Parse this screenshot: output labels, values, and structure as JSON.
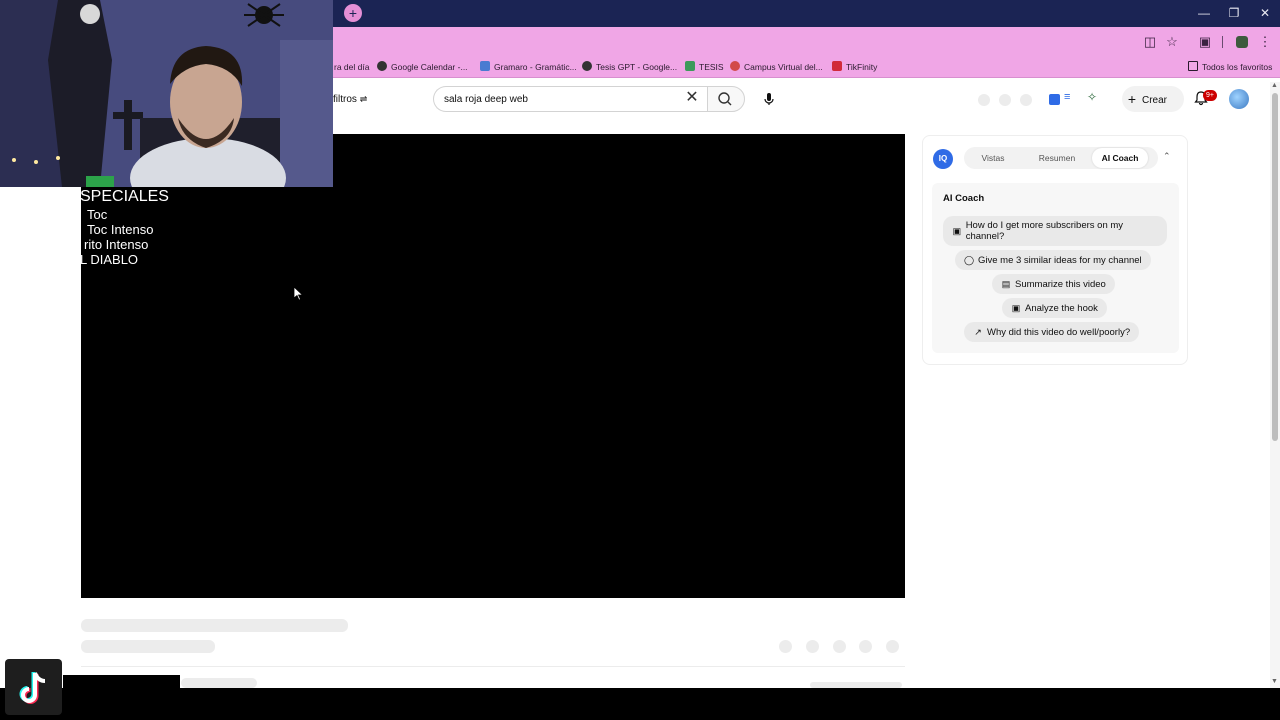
{
  "browser": {
    "bookmarks": [
      "ra del día",
      "Google Calendar -...",
      "Gramaro - Gramátic...",
      "Tesis GPT - Google...",
      "TESIS",
      "Campus Virtual del...",
      "TikFinity"
    ],
    "bookmarks_all": "Todos los favoritos",
    "newtab_icon": "+",
    "window_controls": [
      "minimize-icon",
      "restore-icon",
      "close-icon"
    ]
  },
  "youtube": {
    "filters_label": "filtros",
    "search_value": "sala roja deep web",
    "create_label": "Crear",
    "notification_count": "9+"
  },
  "video_overlay": {
    "lines": [
      "SPECIALES",
      "Toc",
      "Toc Intenso",
      "rito Intenso",
      "L DIABLO"
    ]
  },
  "coach": {
    "logo": "IQ",
    "tabs": [
      "Vistas",
      "Resumen",
      "AI Coach"
    ],
    "active_tab": "AI Coach",
    "title": "AI Coach",
    "prompts": [
      {
        "icon": "video-icon",
        "text": "How do I get more subscribers on my channel?"
      },
      {
        "icon": "lightbulb-icon",
        "text": "Give me 3 similar ideas for my channel"
      },
      {
        "icon": "document-icon",
        "text": "Summarize this video"
      },
      {
        "icon": "video-icon",
        "text": "Analyze the hook"
      },
      {
        "icon": "chart-icon",
        "text": "Why did this video do well/poorly?"
      }
    ]
  },
  "colors": {
    "tabstrip": "#1b2454",
    "toolbar": "#f0a6e6",
    "coach_accent": "#2f6be6",
    "notification_badge": "#cc0000"
  }
}
